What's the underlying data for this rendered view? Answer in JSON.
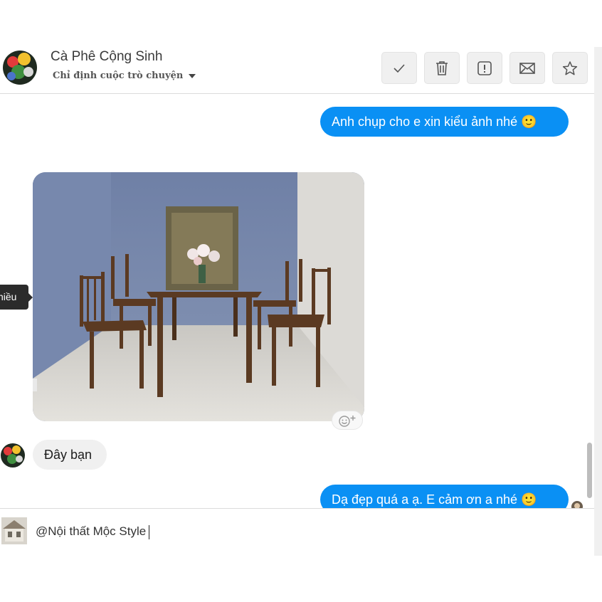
{
  "conversation": {
    "title": "Cà Phê Cộng Sinh",
    "assign_label": "Chỉ định cuộc trò chuyện"
  },
  "toolbar": {
    "done": "check-icon",
    "delete": "trash-icon",
    "spam": "alert-icon",
    "unread": "envelope-icon",
    "star": "star-icon"
  },
  "messages": [
    {
      "from": "me",
      "text": "Anh chụp cho e xin kiểu ảnh nhé 🙂"
    },
    {
      "from": "them",
      "type": "photo",
      "description_icon": "dining-table-photo"
    },
    {
      "from": "them",
      "text": "Đây bạn"
    },
    {
      "from": "me",
      "text": "Dạ đẹp quá a ạ. E cảm ơn a nhé 🙂"
    }
  ],
  "tooltip": {
    "text": "chiều"
  },
  "composer": {
    "value": "@Nội thất Mộc Style"
  },
  "colors": {
    "accent": "#0a90f4",
    "incoming": "#f0f0f0"
  }
}
